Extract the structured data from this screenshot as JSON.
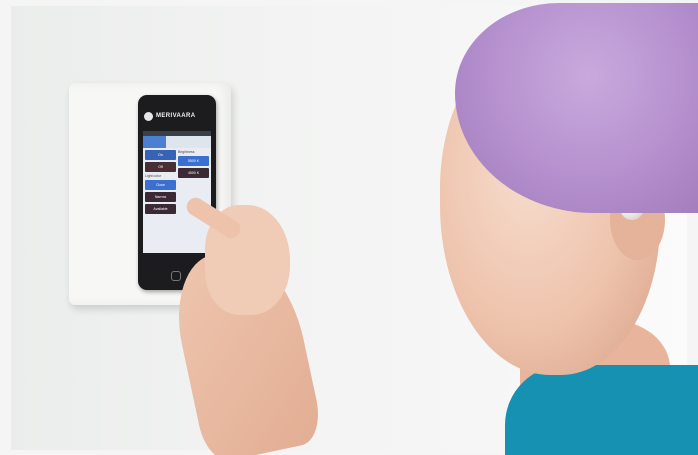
{
  "photo": {
    "brand_name": "MERIVAARA",
    "device_ui": {
      "tabs": [
        "",
        "",
        ""
      ],
      "buttons_left": [
        "On",
        "Off"
      ],
      "buttons_lower": [
        "Close",
        "Narrow",
        "Available",
        "5500 K",
        "4500 K"
      ],
      "label": "Brightness",
      "info_text": "Light color"
    }
  }
}
